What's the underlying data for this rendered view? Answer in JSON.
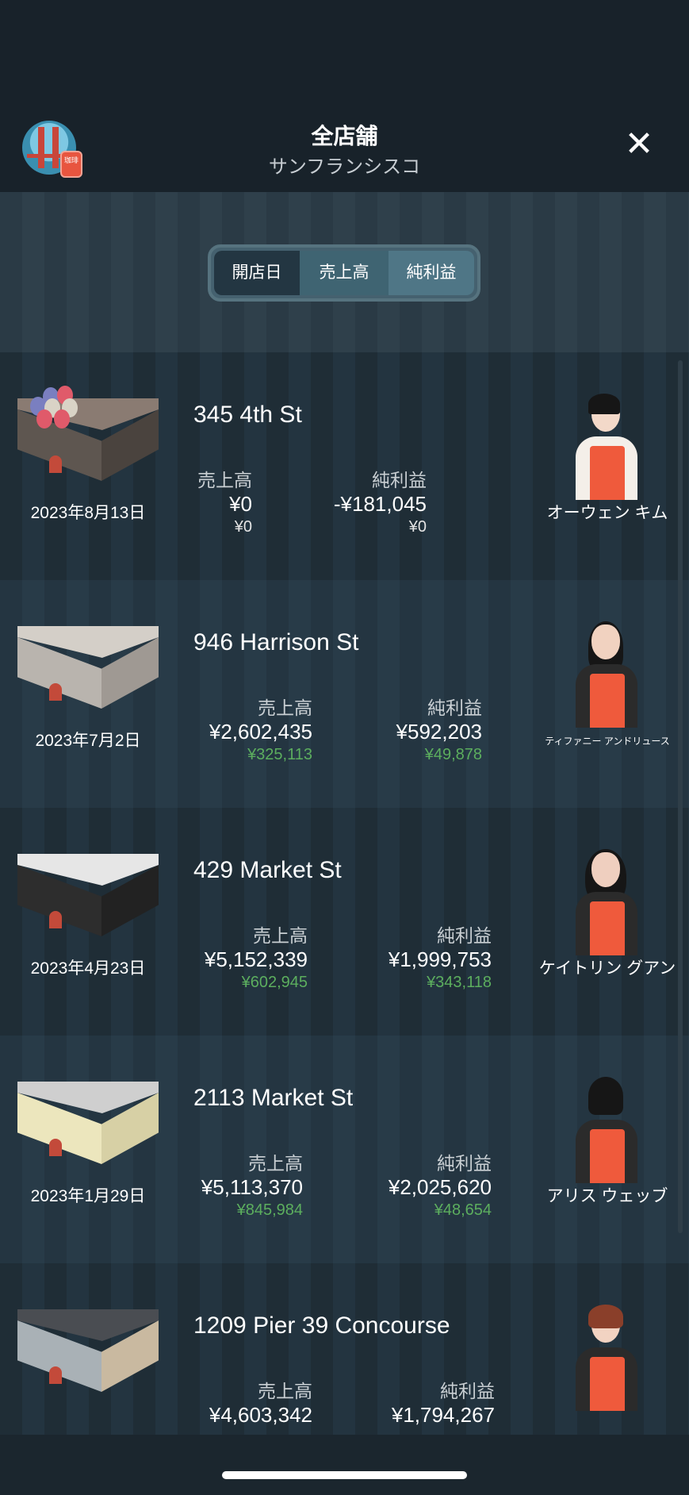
{
  "header": {
    "title": "全店舗",
    "subtitle": "サンフランシスコ",
    "close_glyph": "✕",
    "logo_stamp": "珈琲"
  },
  "sort_tabs": [
    {
      "label": "開店日"
    },
    {
      "label": "売上高"
    },
    {
      "label": "純利益"
    }
  ],
  "stores": [
    {
      "address": "345 4th St",
      "opened": "2023年8月13日",
      "sales_label": "売上高",
      "sales": "¥0",
      "sales_sub": "¥0",
      "profit_label": "純利益",
      "profit": "-¥181,045",
      "profit_sub": "¥0",
      "sub_color": "white",
      "manager": "オーウェン キム"
    },
    {
      "address": "946 Harrison St",
      "opened": "2023年7月2日",
      "sales_label": "売上高",
      "sales": "¥2,602,435",
      "sales_sub": "¥325,113",
      "profit_label": "純利益",
      "profit": "¥592,203",
      "profit_sub": "¥49,878",
      "sub_color": "green",
      "manager": "ティファニー アンドリュース"
    },
    {
      "address": "429 Market St",
      "opened": "2023年4月23日",
      "sales_label": "売上高",
      "sales": "¥5,152,339",
      "sales_sub": "¥602,945",
      "profit_label": "純利益",
      "profit": "¥1,999,753",
      "profit_sub": "¥343,118",
      "sub_color": "green",
      "manager": "ケイトリン グアン"
    },
    {
      "address": "2113 Market St",
      "opened": "2023年1月29日",
      "sales_label": "売上高",
      "sales": "¥5,113,370",
      "sales_sub": "¥845,984",
      "profit_label": "純利益",
      "profit": "¥2,025,620",
      "profit_sub": "¥48,654",
      "sub_color": "green",
      "manager": "アリス ウェッブ"
    },
    {
      "address": "1209 Pier 39 Concourse",
      "sales_label": "売上高",
      "sales": "¥4,603,342",
      "profit_label": "純利益",
      "profit": "¥1,794,267"
    }
  ],
  "colors": {
    "positive": "#5cae5e",
    "negative": "#d9534f",
    "apron": "#ef5a3c",
    "background": "#1b262e"
  }
}
